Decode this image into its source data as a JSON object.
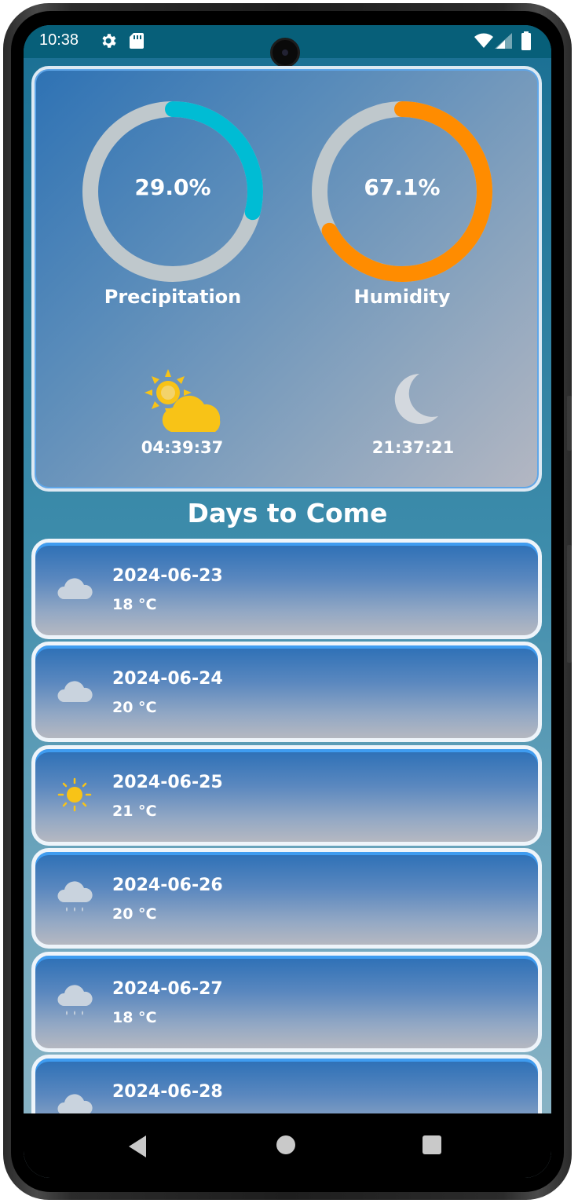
{
  "status_bar": {
    "time": "10:38",
    "icons": [
      "gear-icon",
      "sd-card-icon",
      "wifi-icon",
      "signal-icon",
      "battery-icon"
    ]
  },
  "stats": {
    "precipitation": {
      "value_text": "29.0%",
      "fraction": 0.29,
      "label": "Precipitation",
      "color": "#00bcd4"
    },
    "humidity": {
      "value_text": "67.1%",
      "fraction": 0.671,
      "label": "Humidity",
      "color": "#ff8c00"
    },
    "track_color": "#bfc8cc"
  },
  "sun": {
    "icon": "partly-sunny-icon",
    "time": "04:39:37"
  },
  "moon": {
    "icon": "moon-icon",
    "time": "21:37:21"
  },
  "forecast": {
    "title": "Days to Come",
    "days": [
      {
        "date": "2024-06-23",
        "temp": "18 °C",
        "icon": "cloud-icon"
      },
      {
        "date": "2024-06-24",
        "temp": "20 °C",
        "icon": "cloud-icon"
      },
      {
        "date": "2024-06-25",
        "temp": "21 °C",
        "icon": "sun-icon"
      },
      {
        "date": "2024-06-26",
        "temp": "20 °C",
        "icon": "rain-icon"
      },
      {
        "date": "2024-06-27",
        "temp": "18 °C",
        "icon": "rain-icon"
      },
      {
        "date": "2024-06-28",
        "temp": "",
        "icon": "cloud-icon"
      }
    ]
  },
  "nav": {
    "icons": [
      "back-icon",
      "home-icon",
      "recents-icon"
    ]
  }
}
